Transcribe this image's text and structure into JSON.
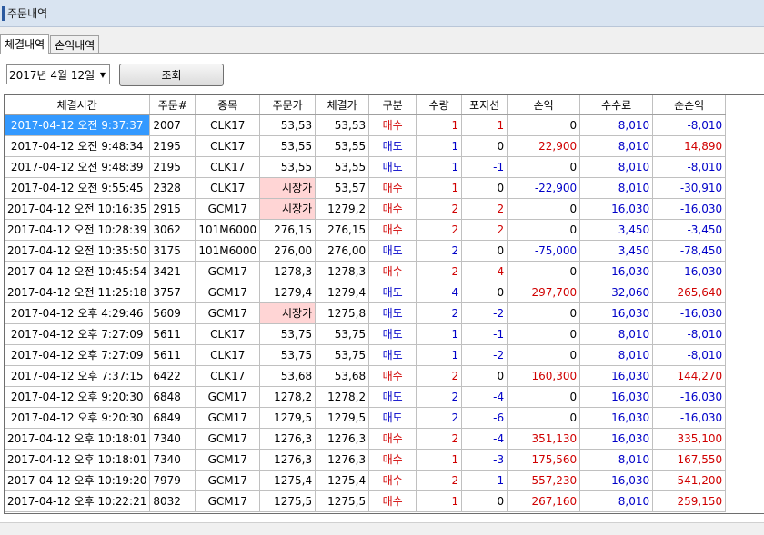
{
  "window": {
    "title": "주문내역"
  },
  "tabs": [
    {
      "label": "체결내역",
      "active": true
    },
    {
      "label": "손익내역",
      "active": false
    }
  ],
  "toolbar": {
    "date_value": "2017년  4월 12일",
    "query_label": "조회"
  },
  "colors": {
    "buy": "#d00000",
    "sell": "#0000c8",
    "selected": "#3399ff",
    "market_price_bg": "#ffd5d5"
  },
  "table": {
    "columns": [
      "체결시간",
      "주문#",
      "종목",
      "주문가",
      "체결가",
      "구분",
      "수량",
      "포지션",
      "손익",
      "수수료",
      "순손익"
    ],
    "rows": [
      {
        "time": "2017-04-12 오전 9:37:37",
        "order": "2007",
        "item": "CLK17",
        "order_price": "53,53",
        "exec_price": "53,53",
        "side": "매수",
        "qty": "1",
        "pos": "1",
        "pnl": "0",
        "fee": "8,010",
        "net": "-8,010"
      },
      {
        "time": "2017-04-12 오전 9:48:34",
        "order": "2195",
        "item": "CLK17",
        "order_price": "53,55",
        "exec_price": "53,55",
        "side": "매도",
        "qty": "1",
        "pos": "0",
        "pnl": "22,900",
        "fee": "8,010",
        "net": "14,890"
      },
      {
        "time": "2017-04-12 오전 9:48:39",
        "order": "2195",
        "item": "CLK17",
        "order_price": "53,55",
        "exec_price": "53,55",
        "side": "매도",
        "qty": "1",
        "pos": "-1",
        "pnl": "0",
        "fee": "8,010",
        "net": "-8,010"
      },
      {
        "time": "2017-04-12 오전 9:55:45",
        "order": "2328",
        "item": "CLK17",
        "order_price": "시장가",
        "exec_price": "53,57",
        "side": "매수",
        "qty": "1",
        "pos": "0",
        "pnl": "-22,900",
        "fee": "8,010",
        "net": "-30,910"
      },
      {
        "time": "2017-04-12 오전 10:16:35",
        "order": "2915",
        "item": "GCM17",
        "order_price": "시장가",
        "exec_price": "1279,2",
        "side": "매수",
        "qty": "2",
        "pos": "2",
        "pnl": "0",
        "fee": "16,030",
        "net": "-16,030"
      },
      {
        "time": "2017-04-12 오전 10:28:39",
        "order": "3062",
        "item": "101M6000",
        "order_price": "276,15",
        "exec_price": "276,15",
        "side": "매수",
        "qty": "2",
        "pos": "2",
        "pnl": "0",
        "fee": "3,450",
        "net": "-3,450"
      },
      {
        "time": "2017-04-12 오전 10:35:50",
        "order": "3175",
        "item": "101M6000",
        "order_price": "276,00",
        "exec_price": "276,00",
        "side": "매도",
        "qty": "2",
        "pos": "0",
        "pnl": "-75,000",
        "fee": "3,450",
        "net": "-78,450"
      },
      {
        "time": "2017-04-12 오전 10:45:54",
        "order": "3421",
        "item": "GCM17",
        "order_price": "1278,3",
        "exec_price": "1278,3",
        "side": "매수",
        "qty": "2",
        "pos": "4",
        "pnl": "0",
        "fee": "16,030",
        "net": "-16,030"
      },
      {
        "time": "2017-04-12 오전 11:25:18",
        "order": "3757",
        "item": "GCM17",
        "order_price": "1279,4",
        "exec_price": "1279,4",
        "side": "매도",
        "qty": "4",
        "pos": "0",
        "pnl": "297,700",
        "fee": "32,060",
        "net": "265,640"
      },
      {
        "time": "2017-04-12 오후 4:29:46",
        "order": "5609",
        "item": "GCM17",
        "order_price": "시장가",
        "exec_price": "1275,8",
        "side": "매도",
        "qty": "2",
        "pos": "-2",
        "pnl": "0",
        "fee": "16,030",
        "net": "-16,030"
      },
      {
        "time": "2017-04-12 오후 7:27:09",
        "order": "5611",
        "item": "CLK17",
        "order_price": "53,75",
        "exec_price": "53,75",
        "side": "매도",
        "qty": "1",
        "pos": "-1",
        "pnl": "0",
        "fee": "8,010",
        "net": "-8,010"
      },
      {
        "time": "2017-04-12 오후 7:27:09",
        "order": "5611",
        "item": "CLK17",
        "order_price": "53,75",
        "exec_price": "53,75",
        "side": "매도",
        "qty": "1",
        "pos": "-2",
        "pnl": "0",
        "fee": "8,010",
        "net": "-8,010"
      },
      {
        "time": "2017-04-12 오후 7:37:15",
        "order": "6422",
        "item": "CLK17",
        "order_price": "53,68",
        "exec_price": "53,68",
        "side": "매수",
        "qty": "2",
        "pos": "0",
        "pnl": "160,300",
        "fee": "16,030",
        "net": "144,270"
      },
      {
        "time": "2017-04-12 오후 9:20:30",
        "order": "6848",
        "item": "GCM17",
        "order_price": "1278,2",
        "exec_price": "1278,2",
        "side": "매도",
        "qty": "2",
        "pos": "-4",
        "pnl": "0",
        "fee": "16,030",
        "net": "-16,030"
      },
      {
        "time": "2017-04-12 오후 9:20:30",
        "order": "6849",
        "item": "GCM17",
        "order_price": "1279,5",
        "exec_price": "1279,5",
        "side": "매도",
        "qty": "2",
        "pos": "-6",
        "pnl": "0",
        "fee": "16,030",
        "net": "-16,030"
      },
      {
        "time": "2017-04-12 오후 10:18:01",
        "order": "7340",
        "item": "GCM17",
        "order_price": "1276,3",
        "exec_price": "1276,3",
        "side": "매수",
        "qty": "2",
        "pos": "-4",
        "pnl": "351,130",
        "fee": "16,030",
        "net": "335,100"
      },
      {
        "time": "2017-04-12 오후 10:18:01",
        "order": "7340",
        "item": "GCM17",
        "order_price": "1276,3",
        "exec_price": "1276,3",
        "side": "매수",
        "qty": "1",
        "pos": "-3",
        "pnl": "175,560",
        "fee": "8,010",
        "net": "167,550"
      },
      {
        "time": "2017-04-12 오후 10:19:20",
        "order": "7979",
        "item": "GCM17",
        "order_price": "1275,4",
        "exec_price": "1275,4",
        "side": "매수",
        "qty": "2",
        "pos": "-1",
        "pnl": "557,230",
        "fee": "16,030",
        "net": "541,200"
      },
      {
        "time": "2017-04-12 오후 10:22:21",
        "order": "8032",
        "item": "GCM17",
        "order_price": "1275,5",
        "exec_price": "1275,5",
        "side": "매수",
        "qty": "1",
        "pos": "0",
        "pnl": "267,160",
        "fee": "8,010",
        "net": "259,150"
      }
    ]
  }
}
